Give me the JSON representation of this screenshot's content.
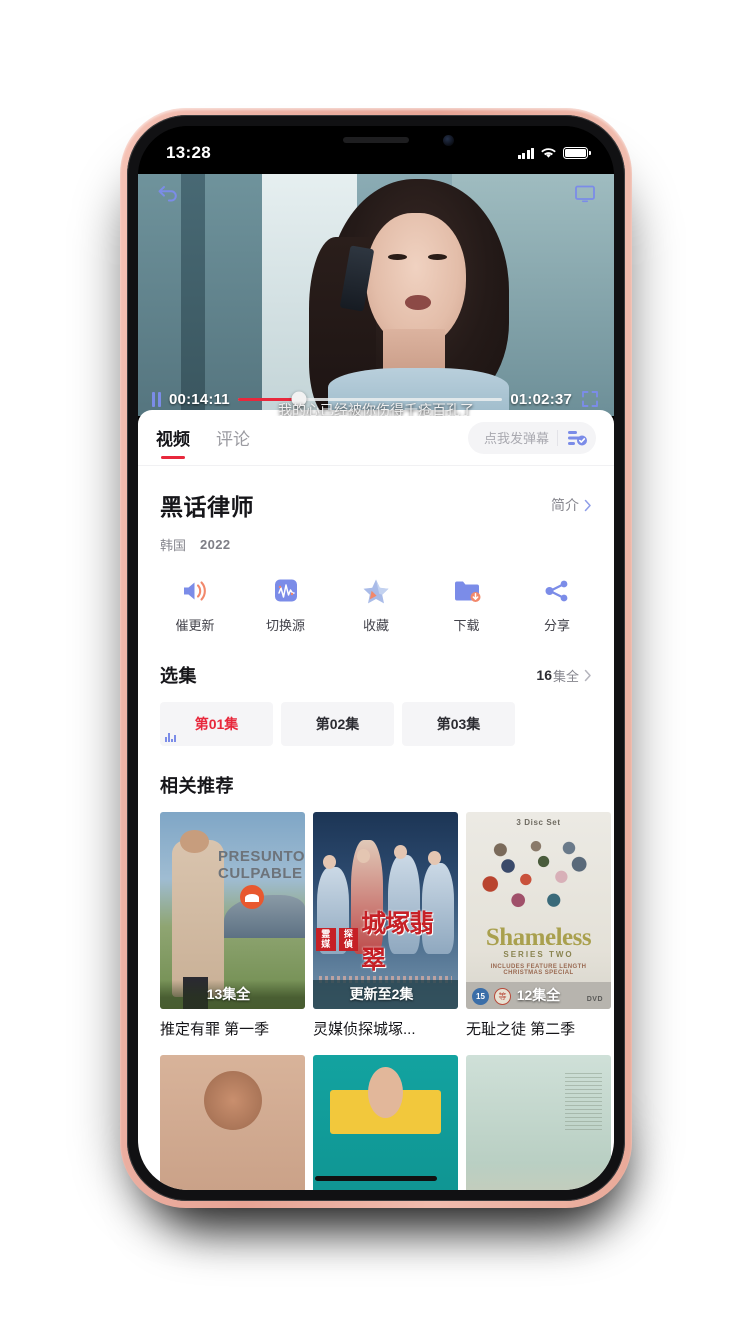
{
  "statusbar": {
    "time": "13:28",
    "signal_icon": "cellular-signal-icon",
    "wifi_icon": "wifi-icon",
    "battery_icon": "battery-icon"
  },
  "player": {
    "back_icon": "back-arrow-icon",
    "cast_icon": "cast-screen-icon",
    "pause_icon": "pause-icon",
    "current_time": "00:14:11",
    "total_time": "01:02:37",
    "progress_percent": 23,
    "fullscreen_icon": "fullscreen-icon",
    "subtitle": "我的心已经被你伤得千疮百孔了"
  },
  "tabs": [
    {
      "label": "视频",
      "active": true
    },
    {
      "label": "评论",
      "active": false
    }
  ],
  "danmaku": {
    "placeholder": "点我发弹幕",
    "settings_icon": "danmaku-settings-icon"
  },
  "detail": {
    "title": "黑话律师",
    "intro_label": "简介",
    "intro_chevron": "chevron-right-icon",
    "region": "韩国",
    "year": "2022"
  },
  "actions": [
    {
      "label": "催更新",
      "icon": "speaker-volume-icon"
    },
    {
      "label": "切换源",
      "icon": "waveform-source-icon"
    },
    {
      "label": "收藏",
      "icon": "star-favorite-icon"
    },
    {
      "label": "下载",
      "icon": "folder-download-icon"
    },
    {
      "label": "分享",
      "icon": "share-nodes-icon"
    }
  ],
  "episodes_section": {
    "title": "选集",
    "count_label": "16集全",
    "count_number": "16",
    "count_suffix": "集全",
    "chevron": "chevron-right-icon",
    "items": [
      {
        "label": "第01集",
        "active": true,
        "playing_icon": "equalizer-playing-icon"
      },
      {
        "label": "第02集",
        "active": false
      },
      {
        "label": "第03集",
        "active": false
      }
    ]
  },
  "recommend_section": {
    "title": "相关推荐",
    "items": [
      {
        "title": "推定有罪 第一季",
        "badge": "13集全",
        "poster_text_line1": "PRESUNTO",
        "poster_text_line2": "CULPABLE"
      },
      {
        "title": "灵媒侦探城塚...",
        "badge": "更新至2集",
        "poster_sq1": "霊媒",
        "poster_sq2": "探偵",
        "poster_big": "城塚翡翠"
      },
      {
        "title": "无耻之徒  第二季",
        "badge": "12集全",
        "poster_top": "3 Disc Set",
        "poster_main": "Shameless",
        "poster_sub": "SERIES TWO",
        "poster_note": "INCLUDES FEATURE LENGTH CHRISTMAS SPECIAL",
        "rating1": "15",
        "rating2": "等",
        "dvd_label": "DVD"
      }
    ]
  },
  "colors": {
    "accent_red": "#e8283c",
    "accent_blue": "#7b8ce8",
    "text_primary": "#16161a",
    "text_secondary": "#86868e",
    "chip_bg": "#f5f5f7",
    "device_frame": "#edb3a6"
  }
}
